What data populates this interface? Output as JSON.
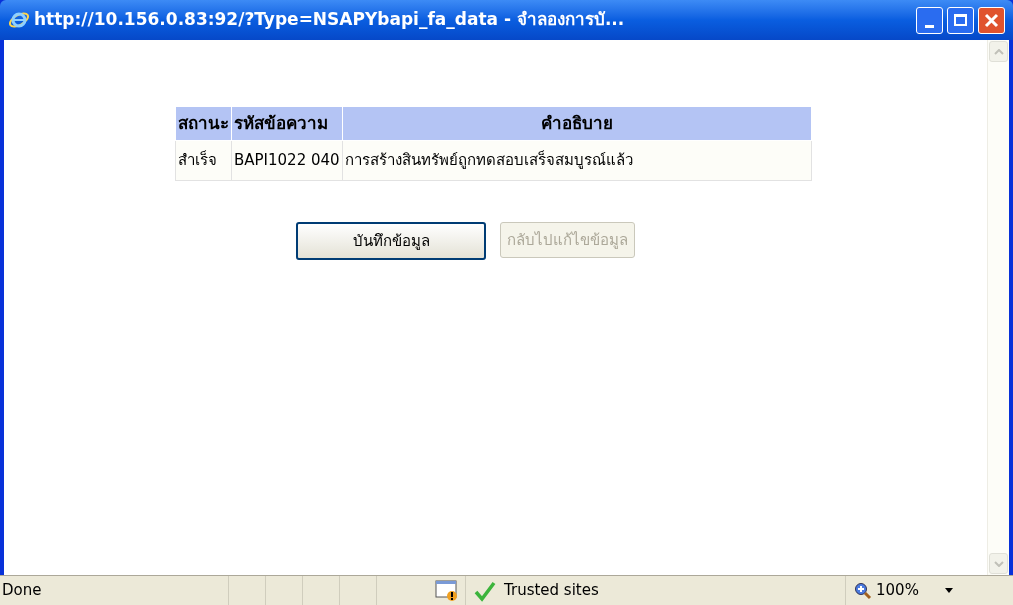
{
  "window": {
    "title": "http://10.156.0.83:92/?Type=NSAPYbapi_fa_data - จำลองการบั..."
  },
  "table": {
    "columns": [
      "สถานะ",
      "รหัสข้อความ",
      "คำอธิบาย"
    ],
    "rows": [
      [
        "สำเร็จ",
        "BAPI1022 040",
        "การสร้างสินทรัพย์ถูกทดสอบเสร็จสมบูรณ์แล้ว"
      ]
    ]
  },
  "buttons": [
    {
      "label": "บันทึกข้อมูล",
      "disabled": false
    },
    {
      "label": "กลับไปแก้ไขข้อมูล",
      "disabled": true
    }
  ],
  "status_bar": {
    "text": "Done",
    "zone": "Trusted sites",
    "zoom": "100%"
  }
}
